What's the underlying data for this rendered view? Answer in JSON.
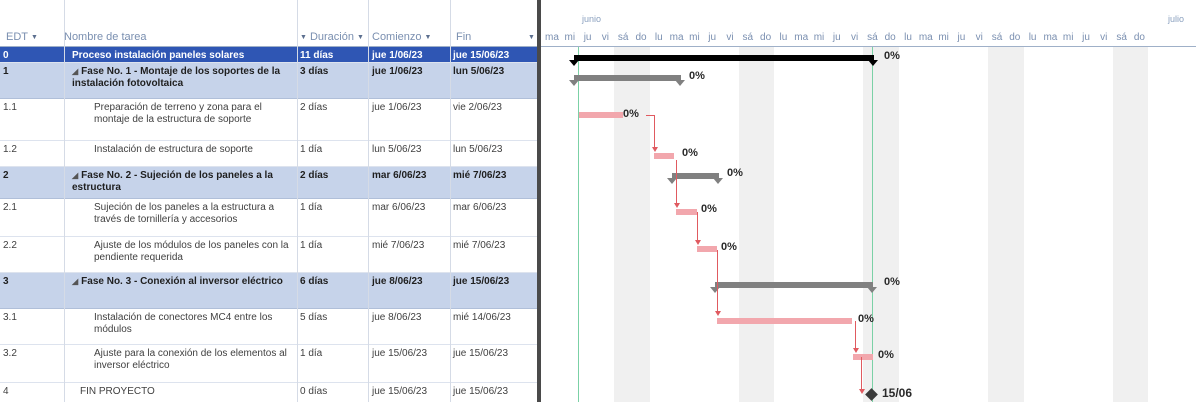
{
  "headers": {
    "edt": "EDT",
    "name": "Nombre de tarea",
    "duration": "Duración",
    "start": "Comienzo",
    "end": "Fin"
  },
  "timeline": {
    "months": [
      "junio",
      "julio"
    ],
    "days": [
      "ma",
      "mi",
      "ju",
      "vi",
      "sá",
      "do",
      "lu",
      "ma",
      "mi",
      "ju",
      "vi",
      "sá",
      "do",
      "lu",
      "ma",
      "mi",
      "ju",
      "vi",
      "sá",
      "do",
      "lu",
      "ma",
      "mi",
      "ju",
      "vi",
      "sá",
      "do",
      "lu",
      "ma",
      "mi",
      "ju",
      "vi",
      "sá",
      "do"
    ]
  },
  "rows": [
    {
      "id": "0",
      "name": "Proceso instalación paneles solares",
      "duration": "11 días",
      "start": "jue 1/06/23",
      "end": "jue 15/06/23",
      "pct": "0%"
    },
    {
      "id": "1",
      "name": "Fase No. 1 - Montaje de los soportes de la instalación fotovoltaica",
      "duration": "3 días",
      "start": "jue 1/06/23",
      "end": "lun 5/06/23",
      "pct": "0%"
    },
    {
      "id": "1.1",
      "name": "Preparación de terreno y zona para el montaje de la estructura de soporte",
      "duration": "2 días",
      "start": "jue 1/06/23",
      "end": "vie 2/06/23",
      "pct": "0%"
    },
    {
      "id": "1.2",
      "name": "Instalación de estructura de soporte",
      "duration": "1 día",
      "start": "lun 5/06/23",
      "end": "lun 5/06/23",
      "pct": "0%"
    },
    {
      "id": "2",
      "name": "Fase No. 2 - Sujeción de los paneles a la estructura",
      "duration": "2 días",
      "start": "mar 6/06/23",
      "end": "mié 7/06/23",
      "pct": "0%"
    },
    {
      "id": "2.1",
      "name": "Sujeción de los paneles a la estructura a través de tornillería y accesorios",
      "duration": "1 día",
      "start": "mar 6/06/23",
      "end": "mar 6/06/23",
      "pct": "0%"
    },
    {
      "id": "2.2",
      "name": "Ajuste de los módulos de los paneles con la pendiente requerida",
      "duration": "1 día",
      "start": "mié 7/06/23",
      "end": "mié 7/06/23",
      "pct": "0%"
    },
    {
      "id": "3",
      "name": "Fase No. 3 - Conexión al inversor eléctrico",
      "duration": "6 días",
      "start": "jue 8/06/23",
      "end": "jue 15/06/23",
      "pct": "0%"
    },
    {
      "id": "3.1",
      "name": "Instalación de conectores MC4 entre los módulos",
      "duration": "5 días",
      "start": "jue 8/06/23",
      "end": "mié 14/06/23",
      "pct": "0%"
    },
    {
      "id": "3.2",
      "name": "Ajuste para la conexión de los elementos al inversor eléctrico",
      "duration": "1 día",
      "start": "jue 15/06/23",
      "end": "jue 15/06/23",
      "pct": "0%"
    },
    {
      "id": "4",
      "name": "FIN PROYECTO",
      "duration": "0 días",
      "start": "jue 15/06/23",
      "end": "jue 15/06/23",
      "pct": "15/06"
    }
  ]
}
